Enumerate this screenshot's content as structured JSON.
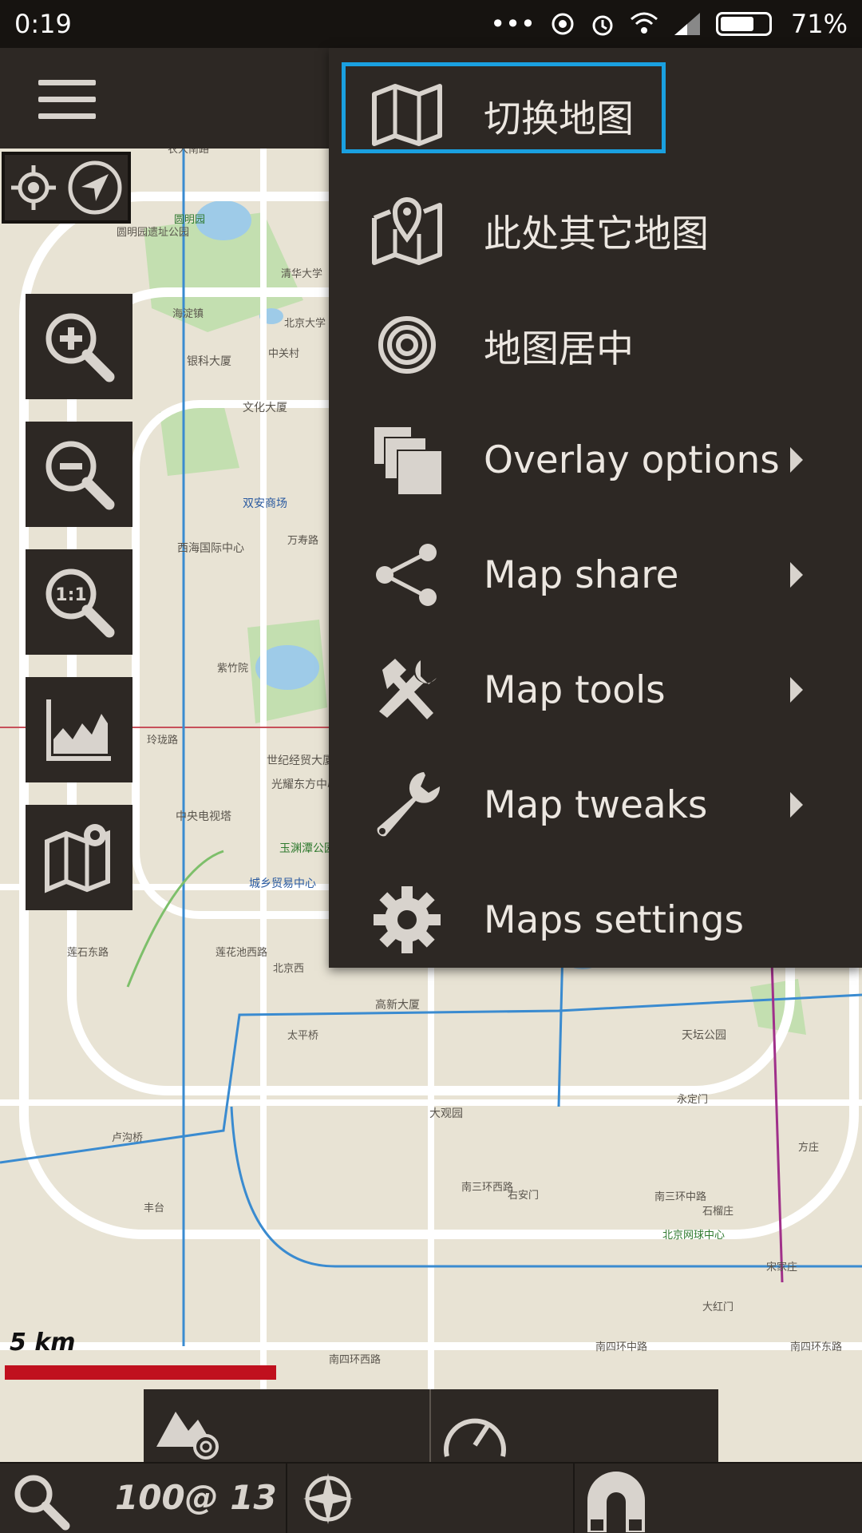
{
  "status_bar": {
    "time": "0:19",
    "dots": "•••",
    "battery_percent": "71%",
    "battery_level": 0.71
  },
  "menu": {
    "items": [
      {
        "label": "切换地图",
        "icon": "map-icon",
        "has_submenu": false,
        "selected": true
      },
      {
        "label": "此处其它地图",
        "icon": "map-pin-icon",
        "has_submenu": false
      },
      {
        "label": "地图居中",
        "icon": "target-icon",
        "has_submenu": false
      },
      {
        "label": "Overlay options",
        "icon": "layers-icon",
        "has_submenu": true
      },
      {
        "label": "Map share",
        "icon": "share-icon",
        "has_submenu": true
      },
      {
        "label": "Map tools",
        "icon": "tools-icon",
        "has_submenu": true
      },
      {
        "label": "Map tweaks",
        "icon": "wrench-icon",
        "has_submenu": true
      },
      {
        "label": "Maps settings",
        "icon": "gear-icon",
        "has_submenu": false
      }
    ]
  },
  "map": {
    "scale_label": "5 km",
    "labels": {
      "l1": "农大南路",
      "l2": "圆明园",
      "l3": "圆明园遗址公园",
      "l4": "清华大学",
      "l5": "北京大学",
      "l6": "海淀镇",
      "l7": "中关村",
      "l8": "银科大厦",
      "l9": "文化大厦",
      "l10": "双安商场",
      "l11": "西海国际中心",
      "l12": "紫竹院",
      "l13": "玲珑路",
      "l14": "世纪经贸大厦",
      "l15": "光耀东方中心",
      "l16": "中央电视塔",
      "l17": "玉渊潭公园",
      "l18": "城乡贸易中心",
      "l19": "莲花池西路",
      "l20": "北京西",
      "l21": "高新大厦",
      "l22": "天坛公园",
      "l23": "大观园",
      "l24": "永定门",
      "l25": "南三环西路",
      "l26": "南三环中路",
      "l27": "北京网球中心",
      "l28": "南四环西路",
      "l29": "南四环中路",
      "l30": "丰台",
      "l31": "卢沟桥",
      "l32": "万寿路",
      "l33": "莲石东路",
      "l34": "太平桥",
      "l35": "南四环东路",
      "l36": "方庄",
      "l37": "大红门",
      "l38": "宋家庄",
      "l39": "石榴庄",
      "l40": "右安门"
    }
  },
  "bottom": {
    "zoom_readout": "100@ 13"
  }
}
